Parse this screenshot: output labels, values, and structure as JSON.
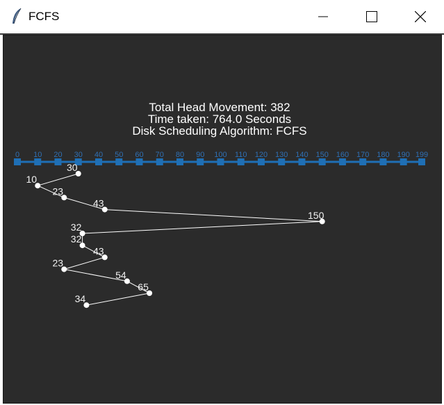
{
  "window": {
    "title": "FCFS",
    "icon": "feather-icon",
    "controls": [
      "minimize-icon",
      "maximize-icon",
      "close-icon"
    ]
  },
  "summary": {
    "line1": "Total Head Movement: 382",
    "line2": "Time taken: 764.0 Seconds",
    "line3": "Disk Scheduling Algorithm: FCFS"
  },
  "colors": {
    "canvas_bg": "#2b2b2b",
    "axis": "#1f6fb5",
    "points": "#ffffff"
  },
  "axis": {
    "min": 0,
    "max": 199,
    "ticks": [
      "0",
      "10",
      "20",
      "30",
      "40",
      "50",
      "60",
      "70",
      "80",
      "90",
      "100",
      "110",
      "120",
      "130",
      "140",
      "150",
      "160",
      "170",
      "180",
      "190",
      "199"
    ],
    "tick_values": [
      0,
      10,
      20,
      30,
      40,
      50,
      60,
      70,
      80,
      90,
      100,
      110,
      120,
      130,
      140,
      150,
      160,
      170,
      180,
      190,
      199
    ]
  },
  "chart_data": {
    "type": "line",
    "x_label": "",
    "x_range": [
      0,
      199
    ],
    "sequence": [
      30,
      10,
      23,
      43,
      150,
      32,
      32,
      43,
      23,
      54,
      65,
      34
    ],
    "labels": [
      "30",
      "10",
      "23",
      "43",
      "150",
      "32",
      "32",
      "43",
      "23",
      "54",
      "65",
      "34"
    ]
  }
}
